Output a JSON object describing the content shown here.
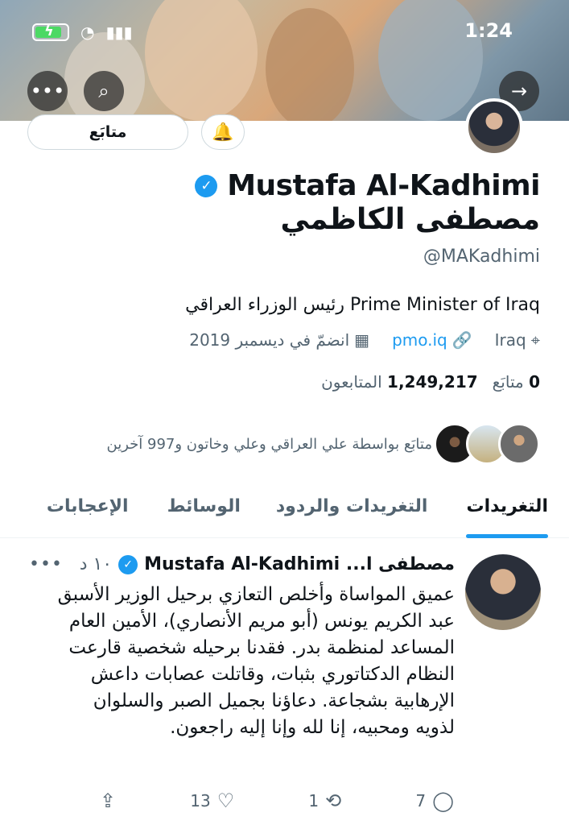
{
  "status_bar": {
    "time": "1:24",
    "wifi_icon": "wifi-icon",
    "signal_icon": "signal-icon"
  },
  "banner": {
    "more_button": "•••",
    "search_button": "⌕",
    "forward_button": "→"
  },
  "profile": {
    "follow_button": "متابَع",
    "notification_button": "🔔",
    "name_en": "Mustafa Al-Kadhimi",
    "name_ar": "مصطفى الكاظمي",
    "handle": "@MAKadhimi",
    "bio": "Prime Minister of Iraq رئيس الوزراء العراقي",
    "location": "Iraq",
    "website": "pmo.iq",
    "joined": "انضمّ في ديسمبر 2019",
    "following_count": "0",
    "following_label": "متابَع",
    "followers_count": "1,249,217",
    "followers_label": "المتابعون",
    "followed_by_text": "متابَع بواسطة علي العراقي وعلي وخاتون و997 آخرين"
  },
  "tabs": [
    {
      "label": "التغريدات"
    },
    {
      "label": "التغريدات والردود"
    },
    {
      "label": "الوسائط"
    },
    {
      "label": "الإعجابات"
    }
  ],
  "tweet": {
    "name": "مصطفى ا... Mustafa Al-Kadhimi",
    "time": "١٠ د",
    "more": "•••",
    "text": "عميق المواساة وأخلص التعازي برحيل الوزير الأسبق عبد الكريم يونس (أبو مريم الأنصاري)، الأمين العام المساعد لمنظمة بدر. فقدنا برحيله شخصية قارعت النظام الدكتاتوري بثبات، وقاتلت عصابات داعش الإرهابية بشجاعة. دعاؤنا بجميل الصبر والسلوان لذويه ومحبيه، إنا لله وإنا إليه راجعون.",
    "replies": "7",
    "retweets": "1",
    "likes": "13"
  },
  "colors": {
    "accent": "#1d9bf0",
    "text": "#0f1419",
    "secondary": "#536471"
  }
}
